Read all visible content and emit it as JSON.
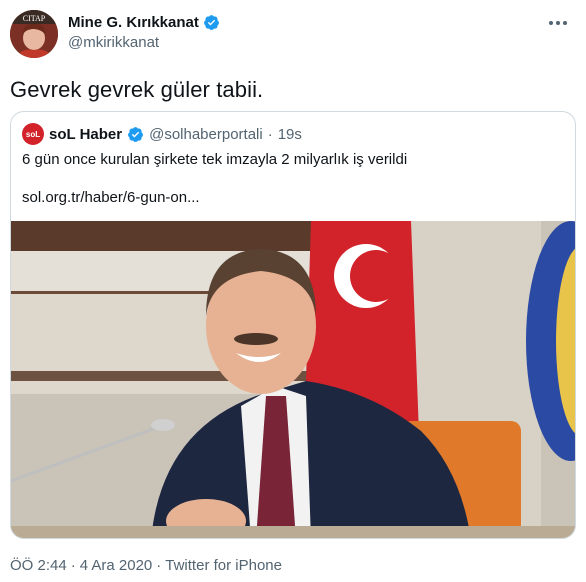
{
  "author": {
    "display_name": "Mine G. Kırıkkanat",
    "handle": "@mkirikkanat",
    "avatar_icon": "profile-photo",
    "avatar_text": "CITAP"
  },
  "tweet": {
    "text": "Gevrek gevrek güler tabii."
  },
  "quoted_tweet": {
    "logo_text": "soL",
    "display_name": "soL Haber",
    "handle": "@solhaberportali",
    "separator": "·",
    "time": "19s",
    "text": "6 gün once kurulan şirkete tek imzayla 2 milyarlık iş verildi",
    "link": "sol.org.tr/haber/6-gun-on..."
  },
  "footer": {
    "time": "ÖÖ 2:44",
    "date": "4 Ara 2020",
    "source": "Twitter for iPhone",
    "separator": "·"
  },
  "colors": {
    "verified": "#1d9bf0",
    "secondary_text": "#536471",
    "border": "#cfd9de",
    "sol_red": "#d2232a"
  }
}
